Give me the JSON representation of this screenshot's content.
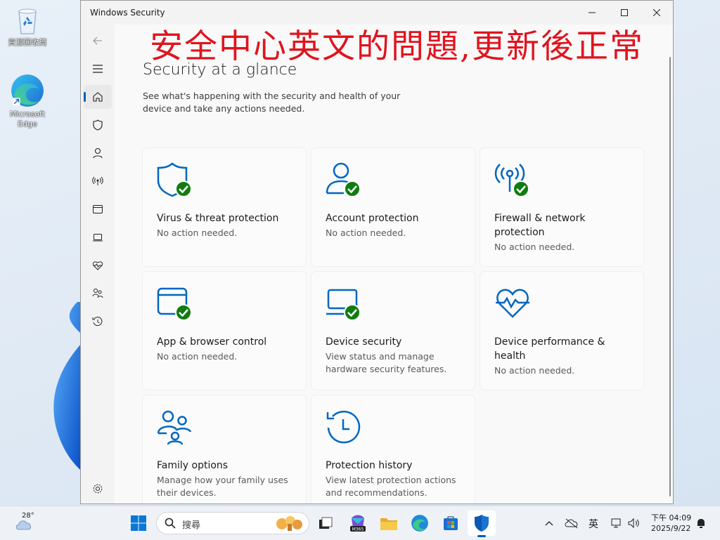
{
  "desktop": {
    "icons": [
      {
        "label": "資源回收筒"
      },
      {
        "label": "Microsoft Edge"
      }
    ]
  },
  "window": {
    "title": "Windows Security",
    "overlay_text": "安全中心英文的問題,更新後正常",
    "page_title": "Security at a glance",
    "page_desc": "See what's happening with the security and health of your device and take any actions needed.",
    "cards": [
      {
        "title": "Virus & threat protection",
        "desc": "No action needed.",
        "icon": "shield-icon",
        "status": "ok"
      },
      {
        "title": "Account protection",
        "desc": "No action needed.",
        "icon": "person-icon",
        "status": "ok"
      },
      {
        "title": "Firewall & network protection",
        "desc": "No action needed.",
        "icon": "wifi-antenna-icon",
        "status": "ok"
      },
      {
        "title": "App & browser control",
        "desc": "No action needed.",
        "icon": "browser-window-icon",
        "status": "ok"
      },
      {
        "title": "Device security",
        "desc": "View status and manage hardware security features.",
        "icon": "laptop-icon",
        "status": "ok"
      },
      {
        "title": "Device performance & health",
        "desc": "No action needed.",
        "icon": "heart-pulse-icon",
        "status": "none"
      },
      {
        "title": "Family options",
        "desc": "Manage how your family uses their devices.",
        "icon": "family-icon",
        "status": "none"
      },
      {
        "title": "Protection history",
        "desc": "View latest protection actions and recommendations.",
        "icon": "history-icon",
        "status": "none"
      }
    ],
    "nav": [
      "back-icon",
      "menu-icon",
      "home-icon",
      "shield-icon",
      "person-icon",
      "wifi-antenna-icon",
      "browser-window-icon",
      "laptop-icon",
      "heart-pulse-icon",
      "family-icon",
      "history-icon",
      "gear-icon"
    ]
  },
  "taskbar": {
    "weather_temp": "28°",
    "search_placeholder": "搜尋",
    "ime": "英",
    "time": "下午 04:09",
    "date": "2025/9/22"
  },
  "colors": {
    "accent": "#0067c0",
    "ok": "#107c10",
    "overlay": "#e0141e"
  }
}
